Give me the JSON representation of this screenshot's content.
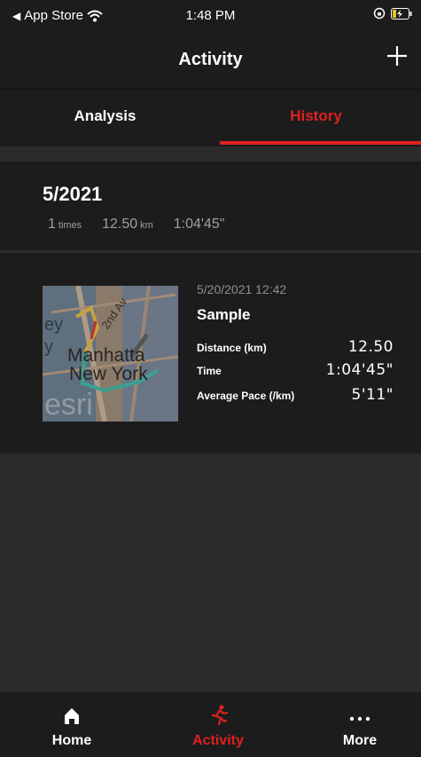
{
  "status": {
    "carrier": "App Store",
    "time": "1:48 PM"
  },
  "nav": {
    "title": "Activity",
    "add_icon": "plus-icon"
  },
  "tabs": {
    "analysis": "Analysis",
    "history": "History",
    "active": "History",
    "accent": "#e02020"
  },
  "month": {
    "title": "5/2021",
    "count": "1",
    "count_unit": "times",
    "distance": "12.50",
    "distance_unit": "km",
    "duration": "1:04'45\""
  },
  "activity": {
    "datetime": "5/20/2021 12:42",
    "name": "Sample",
    "map_thumbnail": "map-thumbnail",
    "map_labels": {
      "place1": "Manhatta",
      "place2": "New York",
      "street": "2nd Av",
      "fragment1": "ey",
      "fragment2": "y",
      "logo": "esri"
    },
    "rows": [
      {
        "label": "Distance (km)",
        "value": "12.50"
      },
      {
        "label": "Time",
        "value": "1:04'45\""
      },
      {
        "label": "Average Pace (/km)",
        "value": "5'11\""
      }
    ]
  },
  "tabbar": {
    "home": "Home",
    "activity": "Activity",
    "more": "More",
    "active": "Activity"
  }
}
